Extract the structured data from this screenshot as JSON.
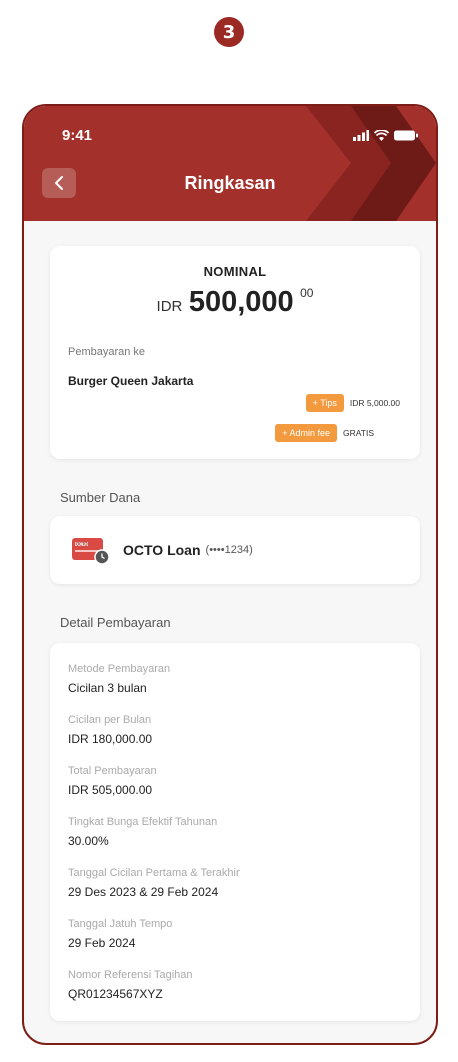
{
  "step_number": "3",
  "status_bar": {
    "time": "9:41"
  },
  "header": {
    "title": "Ringkasan"
  },
  "summary": {
    "nominal_label": "NOMINAL",
    "currency": "IDR",
    "amount": "500,000",
    "decimals": "00",
    "pay_to_label": "Pembayaran ke",
    "merchant": "Burger Queen Jakarta",
    "tips_label": "+ Tips",
    "tips_value": "IDR 5,000.00",
    "admin_fee_label": "+ Admin fee",
    "admin_fee_value": "GRATIS"
  },
  "funding": {
    "section_title": "Sumber Dana",
    "name": "OCTO Loan",
    "masked_number": "(••••1234)",
    "card_icon_text": "OCTO"
  },
  "detail": {
    "section_title": "Detail Pembayaran",
    "items": [
      {
        "label": "Metode Pembayaran",
        "value": "Cicilan 3 bulan"
      },
      {
        "label": "Cicilan per Bulan",
        "value": "IDR 180,000.00"
      },
      {
        "label": "Total Pembayaran",
        "value": "IDR 505,000.00"
      },
      {
        "label": "Tingkat Bunga Efektif Tahunan",
        "value": "30.00%"
      },
      {
        "label": "Tanggal Cicilan Pertama & Terakhir",
        "value": "29 Des 2023 & 29 Feb 2024"
      },
      {
        "label": "Tanggal Jatuh Tempo",
        "value": "29 Feb 2024"
      },
      {
        "label": "Nomor Referensi Tagihan",
        "value": "QR01234567XYZ"
      }
    ]
  },
  "colors": {
    "brand_red": "#a3302a",
    "accent_orange": "#f39a3f"
  },
  "icons": [
    "chevron-left-icon",
    "signal-icon",
    "wifi-icon",
    "battery-icon",
    "credit-card-icon",
    "clock-icon"
  ]
}
